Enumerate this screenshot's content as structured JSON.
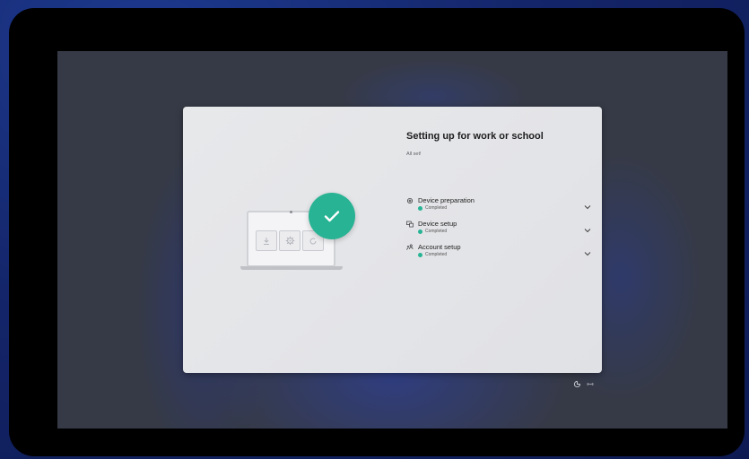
{
  "oobe": {
    "title": "Setting up for work or school",
    "subtitle": "All set!",
    "steps": [
      {
        "label": "Device preparation",
        "status": "Completed",
        "icon": "gear-icon"
      },
      {
        "label": "Device setup",
        "status": "Completed",
        "icon": "devices-icon"
      },
      {
        "label": "Account setup",
        "status": "Completed",
        "icon": "people-icon"
      }
    ]
  },
  "illustration": {
    "icons": [
      "download-icon",
      "gear-icon",
      "refresh-icon",
      "checkmark-icon"
    ]
  },
  "footer": {
    "icons": [
      "accessibility-icon",
      "network-icon"
    ]
  },
  "colors": {
    "accent_green": "#27b394",
    "card_background": "#e5e6e9",
    "screen_background": "#363a46",
    "outer_background": "#14256a"
  }
}
